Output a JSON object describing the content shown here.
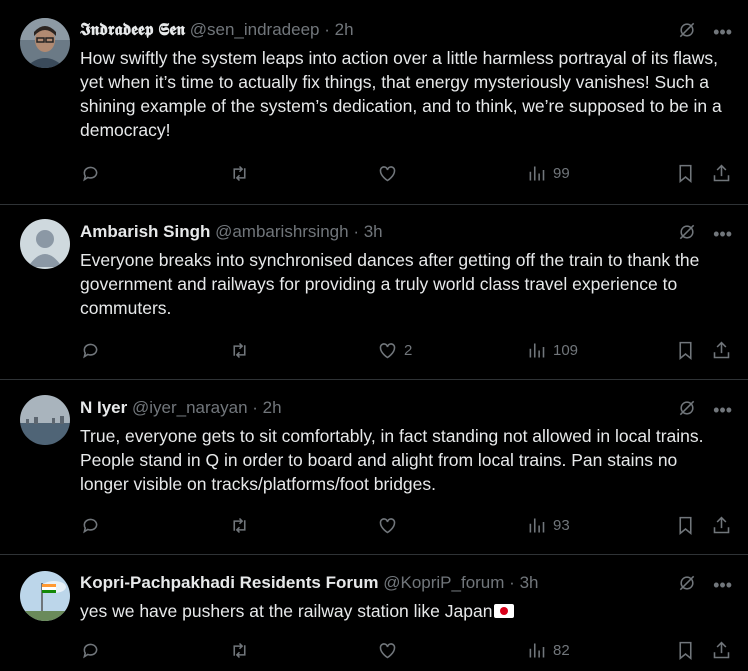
{
  "tweets": [
    {
      "name": "𝕴𝖓𝖉𝖗𝖆𝖉𝖊𝖊𝖕 𝕾𝖊𝖓",
      "handle": "@sen_indradeep",
      "dot": "·",
      "time": "2h",
      "text": "How swiftly the system leaps into action over a little harmless portrayal of its flaws, yet when it’s time to actually fix things, that energy mysteriously vanishes! Such a shining example of the system’s dedication, and to think, we’re supposed to be in a democracy!",
      "likes": "",
      "views": "99",
      "avatar": "photo-man-glasses"
    },
    {
      "name": "Ambarish Singh",
      "handle": "@ambarishrsingh",
      "dot": "·",
      "time": "3h",
      "text": "Everyone breaks into synchronised dances after getting off the train to thank the government and railways for providing a truly world class travel experience to commuters.",
      "likes": "2",
      "views": "109",
      "avatar": "default-avatar"
    },
    {
      "name": "N Iyer",
      "handle": "@iyer_narayan",
      "dot": "·",
      "time": "2h",
      "text": "True, everyone gets to sit comfortably, in fact standing not allowed in local trains. People stand in Q in order to board and alight from local trains. Pan stains no longer visible on tracks/platforms/foot bridges.",
      "likes": "",
      "views": "93",
      "avatar": "photo-seascape"
    },
    {
      "name": "Kopri-Pachpakhadi Residents Forum",
      "handle": "@KopriP_forum",
      "dot": "·",
      "time": "3h",
      "text": "yes we have pushers at the railway station like Japan",
      "likes": "",
      "views": "82",
      "avatar": "photo-flag-sky"
    }
  ],
  "icons": {
    "reply": "reply-icon",
    "retweet": "retweet-icon",
    "like": "like-icon",
    "views": "views-icon",
    "bookmark": "bookmark-icon",
    "share": "share-icon",
    "grok": "grok-icon",
    "more": "more-icon"
  },
  "colors": {
    "background": "#000000",
    "text": "#e7e9ea",
    "muted": "#71767b",
    "divider": "#2f3336"
  }
}
